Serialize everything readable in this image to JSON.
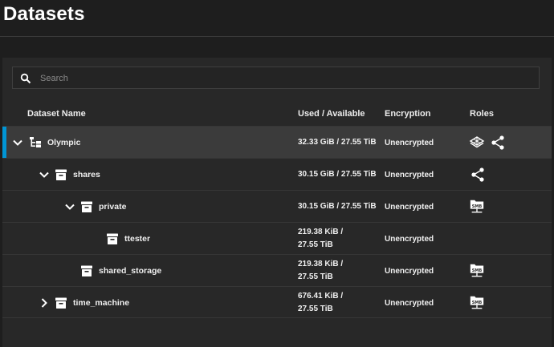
{
  "page": {
    "title": "Datasets"
  },
  "search": {
    "placeholder": "Search"
  },
  "columns": {
    "name": "Dataset Name",
    "used": "Used / Available",
    "encryption": "Encryption",
    "roles": "Roles"
  },
  "rows": [
    {
      "name": "Olympic",
      "used_line1": "32.33 GiB / 27.55 TiB",
      "used_line2": "",
      "encryption": "Unencrypted",
      "roles": [
        "apps-icon",
        "share-icon"
      ],
      "expand": "expanded",
      "selected": true
    },
    {
      "name": "shares",
      "used_line1": "30.15 GiB / 27.55 TiB",
      "used_line2": "",
      "encryption": "Unencrypted",
      "roles": [
        "share-icon"
      ],
      "expand": "expanded"
    },
    {
      "name": "private",
      "used_line1": "30.15 GiB / 27.55 TiB",
      "used_line2": "",
      "encryption": "Unencrypted",
      "roles": [
        "smb-share-icon"
      ],
      "expand": "expanded"
    },
    {
      "name": "ttester",
      "used_line1": "219.38 KiB /",
      "used_line2": "27.55 TiB",
      "encryption": "Unencrypted",
      "roles": [],
      "expand": "none"
    },
    {
      "name": "shared_storage",
      "used_line1": "219.38 KiB /",
      "used_line2": "27.55 TiB",
      "encryption": "Unencrypted",
      "roles": [
        "smb-share-icon"
      ],
      "expand": "none"
    },
    {
      "name": "time_machine",
      "used_line1": "676.41 KiB /",
      "used_line2": "27.55 TiB",
      "encryption": "Unencrypted",
      "roles": [
        "smb-share-icon"
      ],
      "expand": "collapsed"
    }
  ],
  "smb_label": "SMB",
  "colors": {
    "accent": "#0095d5",
    "background": "#1e1e1e",
    "panel": "#282828",
    "selected_row": "#3b3b3b"
  }
}
